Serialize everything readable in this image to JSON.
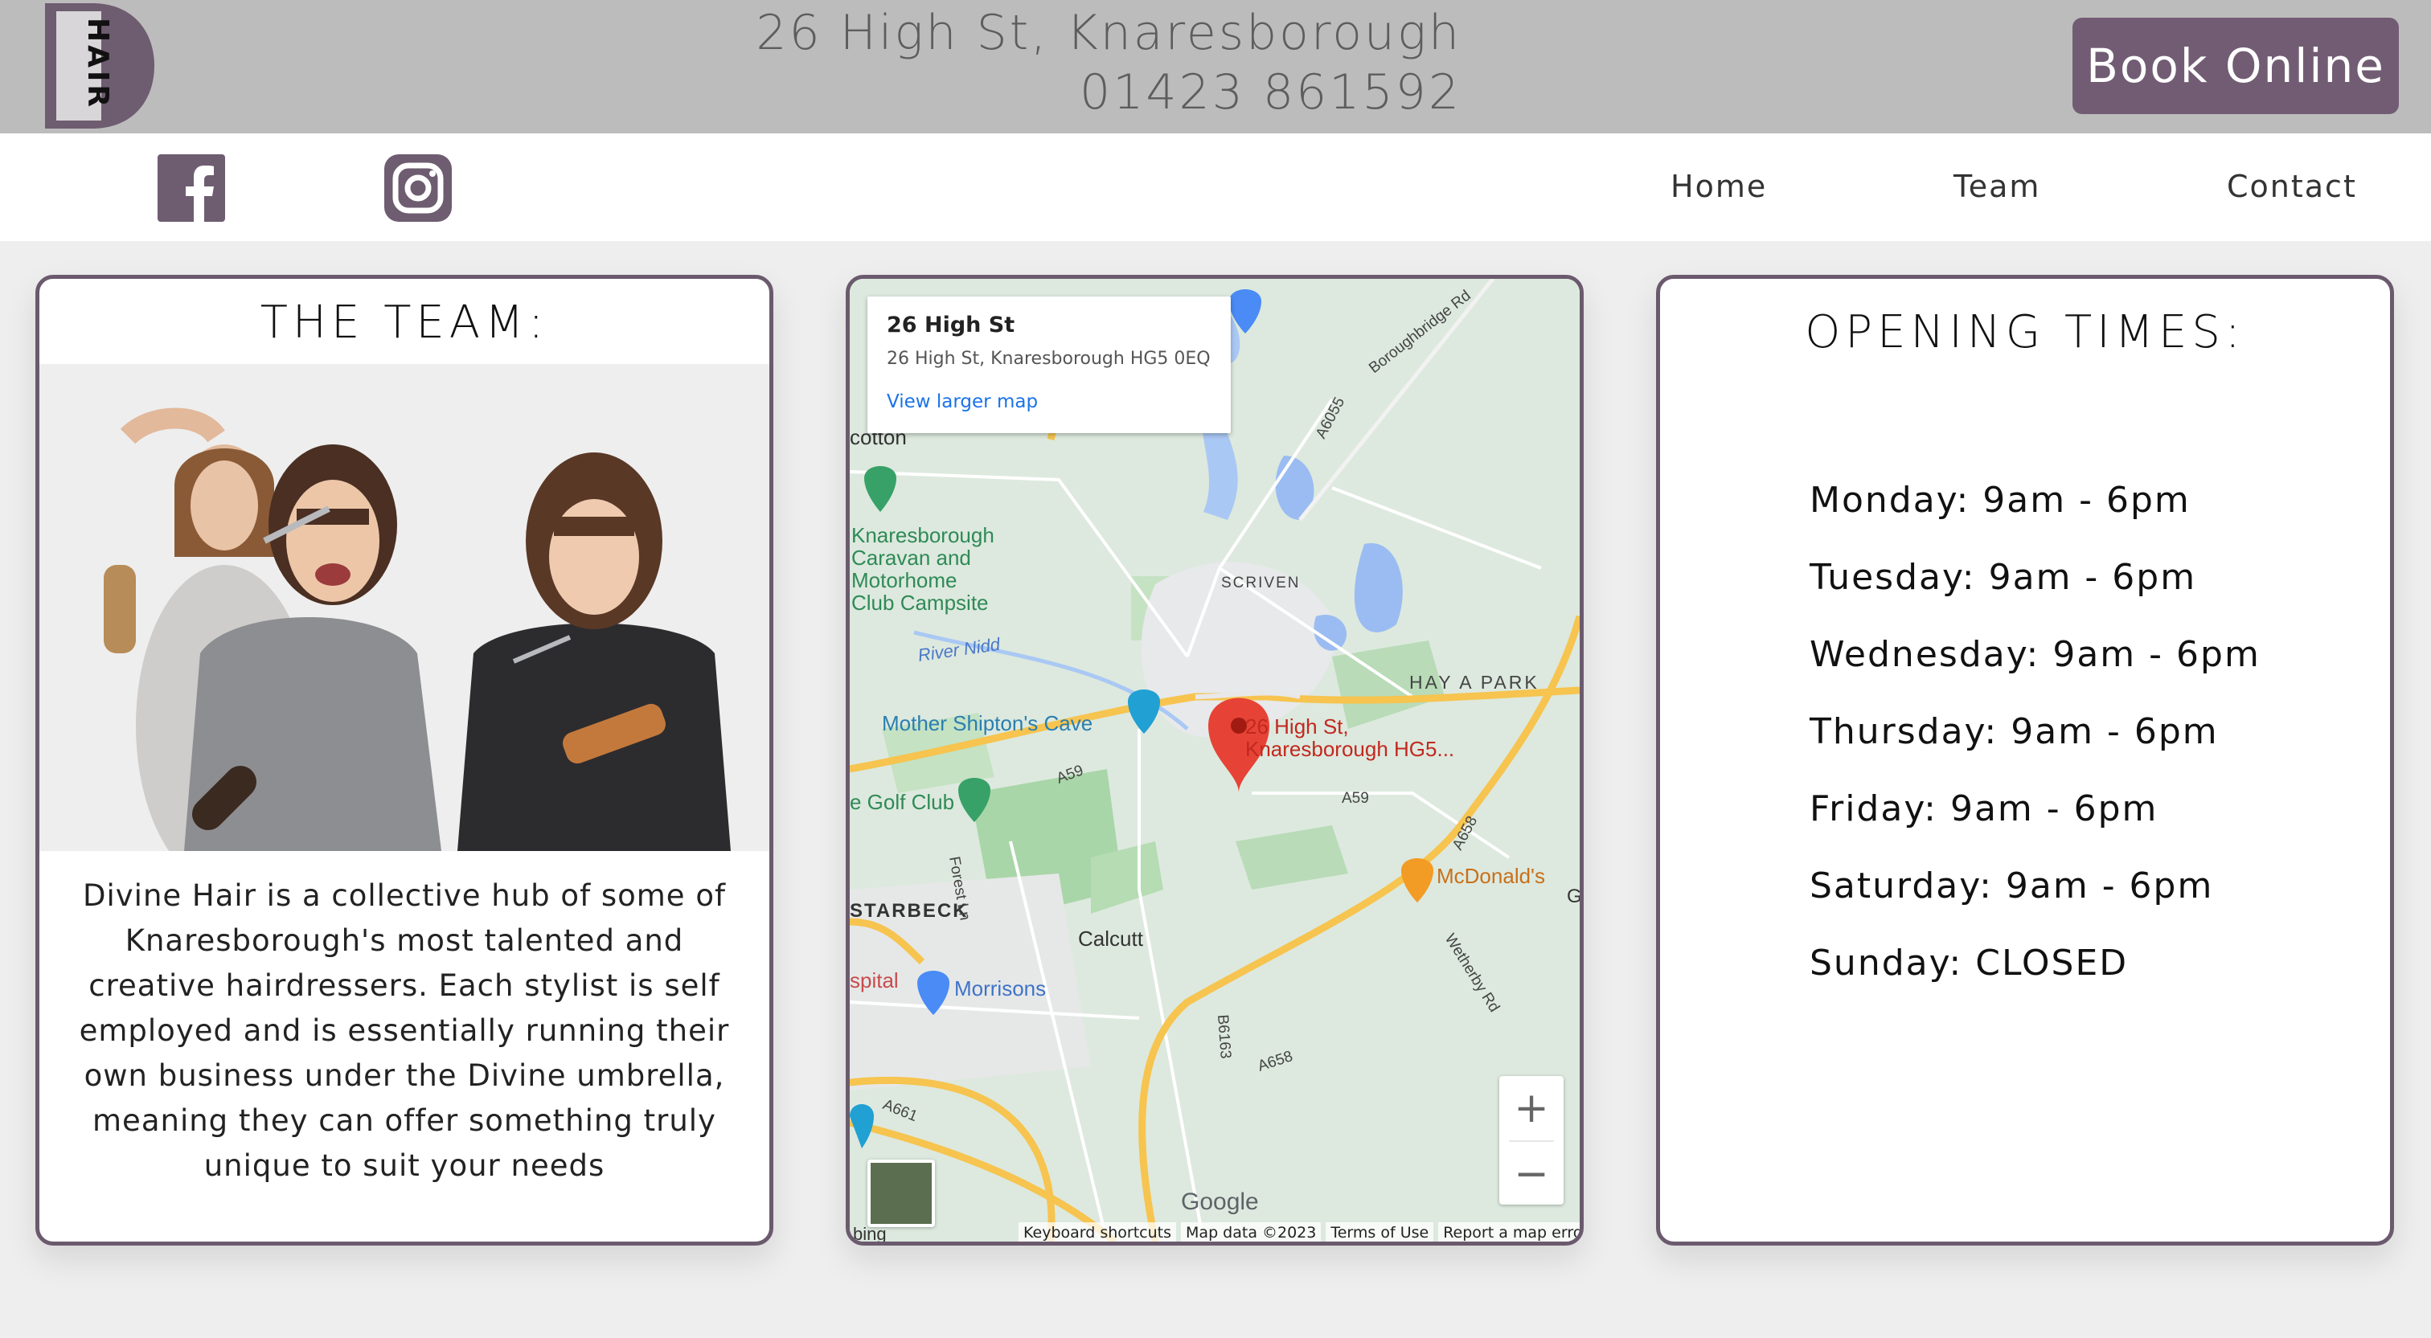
{
  "header": {
    "logo_text": "HAIR",
    "address_line1": "26 High St, Knaresborough",
    "address_line2": "01423 861592",
    "book_button": "Book Online"
  },
  "nav": {
    "items": [
      "Home",
      "Team",
      "Contact"
    ]
  },
  "team": {
    "title": "THE TEAM:",
    "description": "Divine Hair is a collective hub of some of Knaresborough's most talented and creative hairdressers. Each stylist is self employed and is essentially running their own business under the Divine umbrella, meaning they can offer something truly unique to suit your needs"
  },
  "map": {
    "info_title": "26 High St",
    "info_address": "26 High St, Knaresborough HG5 0EQ",
    "info_link": "View larger map",
    "marker_label_line1": "26 High St,",
    "marker_label_line2": "Knaresborough HG5...",
    "places": {
      "caravan1": "Knaresborough",
      "caravan2": "Caravan and",
      "caravan3": "Motorhome",
      "caravan4": "Club Campsite",
      "cotton": "cotton",
      "river": "River Nidd",
      "scriven": "SCRIVEN",
      "hay_a_park": "HAY A PARK",
      "mother_shipton": "Mother Shipton's Cave",
      "golf": "e Golf Club",
      "mcdonalds": "McDonald's",
      "starbeck": "STARBECK",
      "calcutt": "Calcutt",
      "hospital": "spital",
      "morrisons": "Morrisons",
      "forest_ln": "Forest Ln",
      "wetherby": "Wetherby Rd",
      "boroughbridge": "Boroughbridge Rd",
      "a6055": "A6055",
      "a59_left": "A59",
      "a59_right": "A59",
      "a658_top": "A658",
      "a658_bottom": "A658",
      "a661": "A661",
      "b6163": "B6163",
      "g": "G",
      "bing": "bing"
    },
    "zoom_in": "+",
    "zoom_out": "−",
    "google": "Google",
    "footer": [
      "Keyboard shortcuts",
      "Map data ©2023",
      "Terms of Use",
      "Report a map error"
    ]
  },
  "opening": {
    "title": "OPENING TIMES:",
    "rows": [
      "Monday: 9am - 6pm",
      "Tuesday: 9am - 6pm",
      "Wednesday: 9am - 6pm",
      "Thursday: 9am - 6pm",
      "Friday: 9am - 6pm",
      "Saturday: 9am - 6pm",
      "Sunday: CLOSED"
    ]
  },
  "colors": {
    "brand": "#725c74",
    "header_bg": "#bcbcbc",
    "card_border": "#6b5a6e"
  },
  "icons": [
    "facebook-icon",
    "instagram-icon",
    "map-pin-icon",
    "camera-icon",
    "tent-icon",
    "golf-icon",
    "restaurant-icon",
    "shopping-cart-icon"
  ]
}
